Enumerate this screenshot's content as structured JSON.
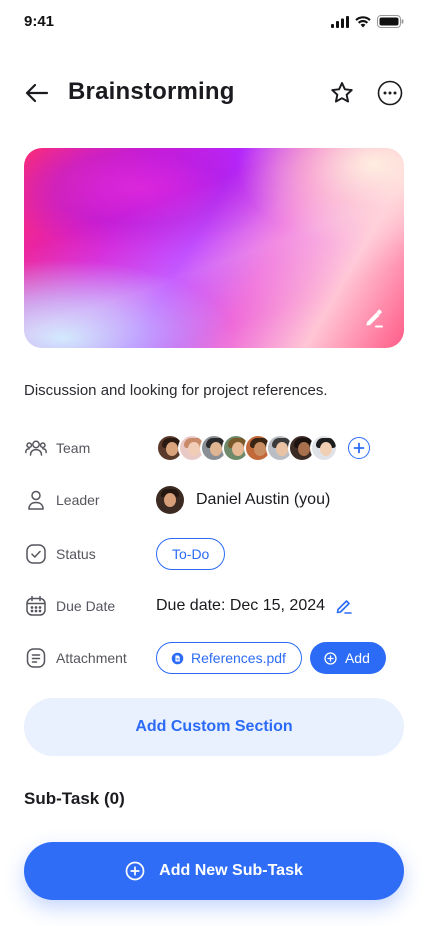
{
  "status_bar": {
    "time": "9:41"
  },
  "header": {
    "title": "Brainstorming"
  },
  "description": "Discussion and looking for project references.",
  "fields": {
    "team": {
      "label": "Team",
      "member_count": 8
    },
    "leader": {
      "label": "Leader",
      "name": "Daniel Austin (you)"
    },
    "status": {
      "label": "Status",
      "value": "To-Do"
    },
    "due_date": {
      "label": "Due Date",
      "value": "Due date: Dec 15, 2024"
    },
    "attachment": {
      "label": "Attachment",
      "file_name": "References.pdf",
      "add_label": "Add"
    }
  },
  "buttons": {
    "add_custom_section": "Add Custom Section",
    "add_new_subtask": "Add New Sub-Task"
  },
  "subtask": {
    "title": "Sub-Task (0)"
  },
  "colors": {
    "accent": "#2c6bf5",
    "accent_light": "#e9f0fe",
    "text": "#1b1b1f",
    "muted": "#55555d"
  },
  "icons": [
    "back-arrow-icon",
    "star-icon",
    "more-icon",
    "edit-pencil-icon",
    "team-icon",
    "leader-icon",
    "status-check-icon",
    "calendar-icon",
    "attachment-icon",
    "plus-icon",
    "document-icon",
    "add-circle-icon"
  ]
}
